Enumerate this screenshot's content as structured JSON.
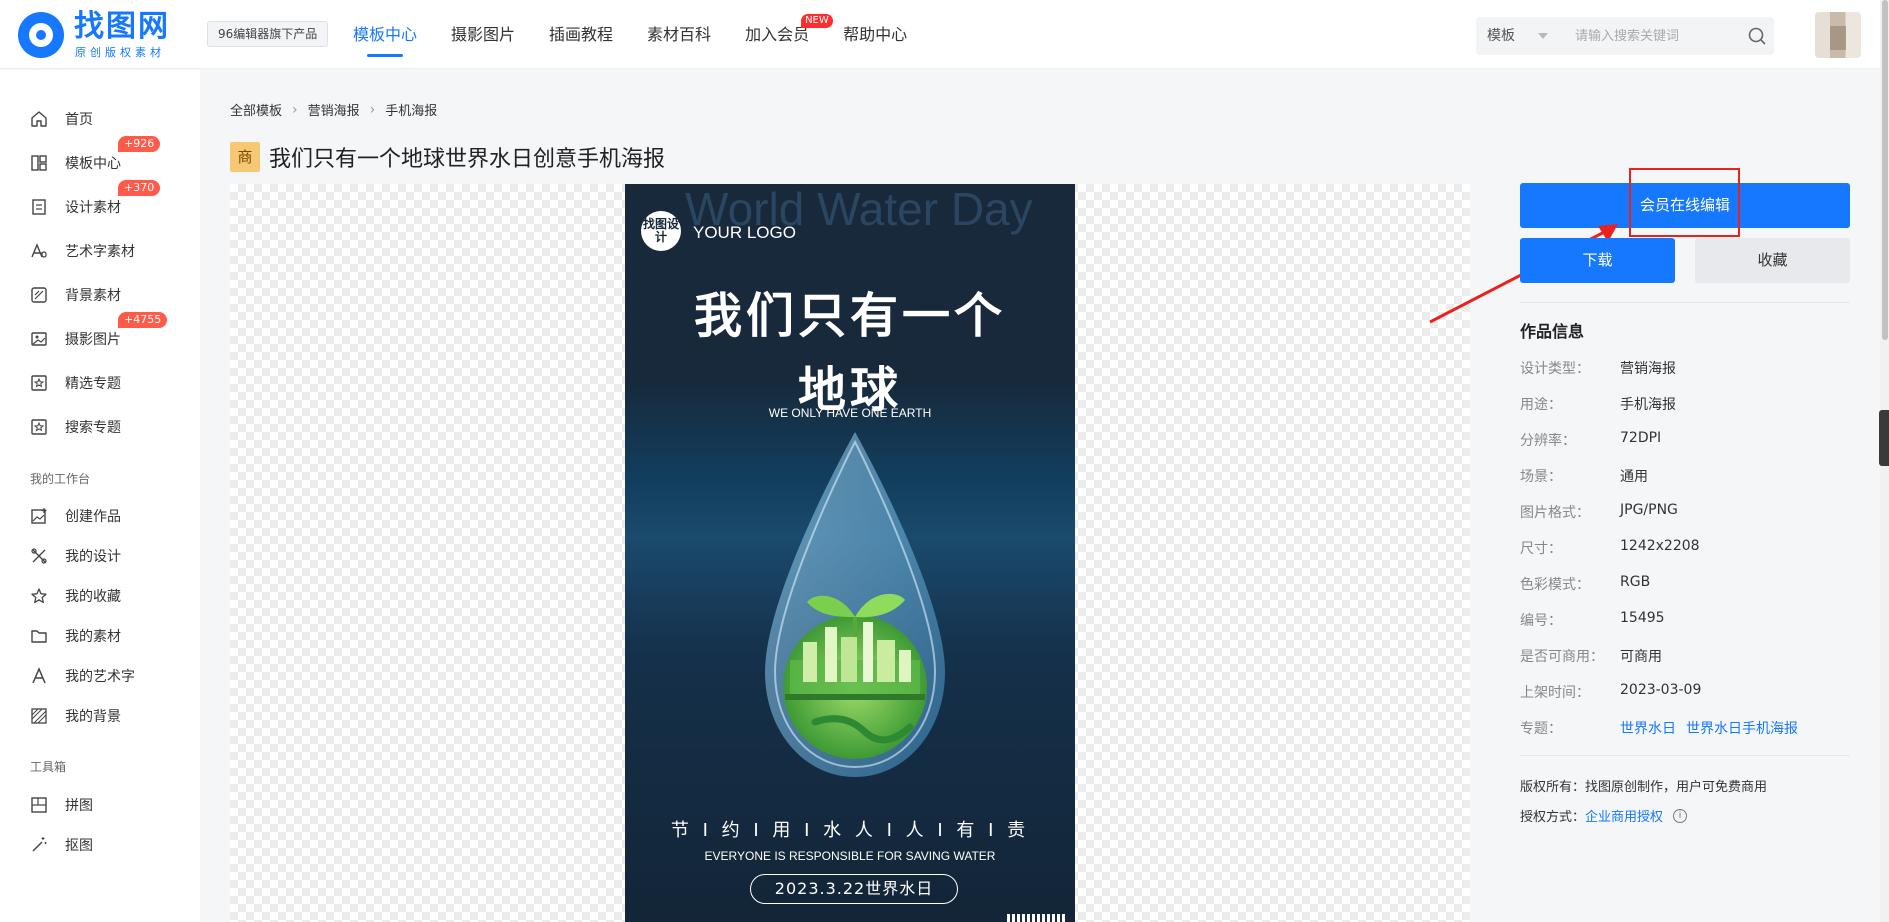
{
  "brand": {
    "name": "找图网",
    "sub": "原创版权素材",
    "product_badge": "96编辑器旗下产品"
  },
  "topnav": [
    {
      "label": "模板中心",
      "active": true
    },
    {
      "label": "摄影图片"
    },
    {
      "label": "插画教程"
    },
    {
      "label": "素材百科"
    },
    {
      "label": "加入会员",
      "tag": "NEW"
    },
    {
      "label": "帮助中心"
    }
  ],
  "search": {
    "type": "模板",
    "placeholder": "请输入搜索关键词"
  },
  "sidebar": {
    "items": [
      {
        "label": "首页"
      },
      {
        "label": "模板中心",
        "count": "+926"
      },
      {
        "label": "设计素材",
        "count": "+370"
      },
      {
        "label": "艺术字素材"
      },
      {
        "label": "背景素材"
      },
      {
        "label": "摄影图片",
        "count": "+4755"
      },
      {
        "label": "精选专题"
      },
      {
        "label": "搜索专题"
      }
    ],
    "workspace_title": "我的工作台",
    "workspace": [
      {
        "label": "创建作品"
      },
      {
        "label": "我的设计"
      },
      {
        "label": "我的收藏"
      },
      {
        "label": "我的素材"
      },
      {
        "label": "我的艺术字"
      },
      {
        "label": "我的背景"
      }
    ],
    "tools_title": "工具箱",
    "tools": [
      {
        "label": "拼图"
      },
      {
        "label": "抠图"
      }
    ]
  },
  "breadcrumb": [
    "全部模板",
    "营销海报",
    "手机海报"
  ],
  "page": {
    "tag": "商",
    "title": "我们只有一个地球世界水日创意手机海报"
  },
  "poster": {
    "watermark": "World Water Day",
    "logo_badge": "找图设计",
    "logo_text": "YOUR LOGO",
    "headline_1": "我们只有一个",
    "headline_2": "地球",
    "subtitle": "WE ONLY HAVE ONE EARTH",
    "slogan": "节 I 约 I 用 I 水   人 I 人 I 有 I 责",
    "slogan_en": "EVERYONE IS RESPONSIBLE FOR SAVING WATER",
    "date": "2023.3.22世界水日"
  },
  "actions": {
    "edit": "会员在线编辑",
    "download": "下载",
    "favorite": "收藏"
  },
  "info": {
    "title": "作品信息",
    "rows": [
      {
        "label": "设计类型：",
        "value": "营销海报"
      },
      {
        "label": "用途：",
        "value": "手机海报"
      },
      {
        "label": "分辨率：",
        "value": "72DPI"
      },
      {
        "label": "场景：",
        "value": "通用"
      },
      {
        "label": "图片格式：",
        "value": "JPG/PNG"
      },
      {
        "label": "尺寸：",
        "value": "1242x2208"
      },
      {
        "label": "色彩模式：",
        "value": "RGB"
      },
      {
        "label": "编号：",
        "value": "15495"
      },
      {
        "label": "是否可商用：",
        "value": "可商用"
      },
      {
        "label": "上架时间：",
        "value": "2023-03-09"
      }
    ],
    "topic_label": "专题：",
    "topics": [
      "世界水日",
      "世界水日手机海报"
    ]
  },
  "copyright": {
    "text": "版权所有：找图原创制作，用户可免费商用",
    "license_label": "授权方式：",
    "license_link": "企业商用授权",
    "info_glyph": "i"
  },
  "colors": {
    "accent": "#1677ff",
    "badge_red": "#ff5b4a",
    "highlight": "#e8231e",
    "poster_bg": "#17293a"
  }
}
